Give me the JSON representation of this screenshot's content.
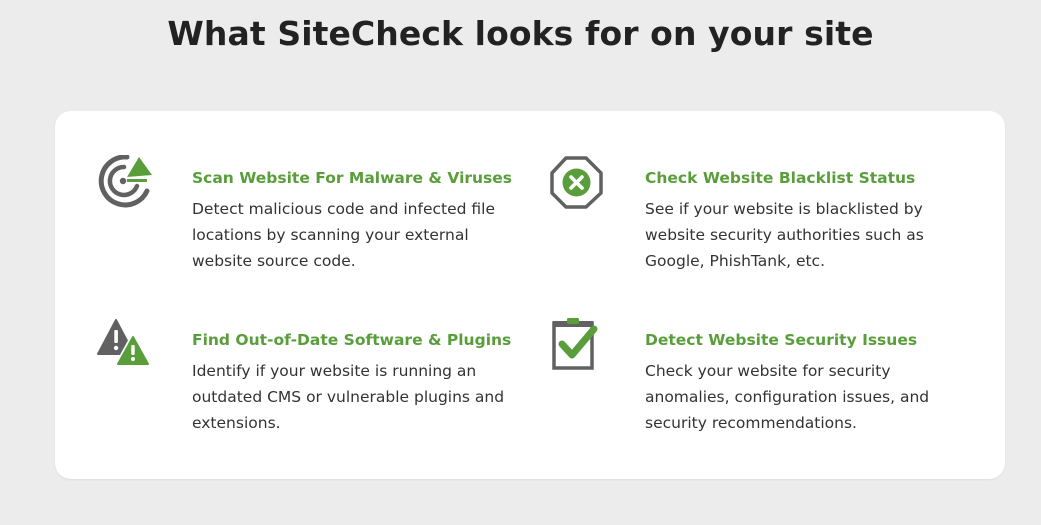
{
  "page": {
    "title": "What SiteCheck looks for on your site"
  },
  "colors": {
    "accent_green": "#5a9e3c",
    "icon_gray": "#616161",
    "background": "#ececec",
    "card": "#ffffff"
  },
  "features": [
    {
      "icon": "malware-scan-icon",
      "title": "Scan Website For Malware & Viruses",
      "desc_lines": [
        "Detect malicious code and infected file",
        "locations by scanning your external",
        "website source code."
      ]
    },
    {
      "icon": "blacklist-x-icon",
      "title": "Check Website Blacklist Status",
      "desc_lines": [
        "See if your website is blacklisted by",
        "website security authorities such as",
        "Google, PhishTank, etc."
      ]
    },
    {
      "icon": "warning-triangles-icon",
      "title": "Find Out-of-Date Software & Plugins",
      "desc_lines": [
        "Identify if your website is running an",
        "outdated CMS or vulnerable plugins and",
        "extensions."
      ]
    },
    {
      "icon": "clipboard-check-icon",
      "title": "Detect Website Security Issues",
      "desc_lines": [
        "Check your website for security",
        "anomalies, configuration issues, and",
        "security recommendations."
      ]
    }
  ]
}
